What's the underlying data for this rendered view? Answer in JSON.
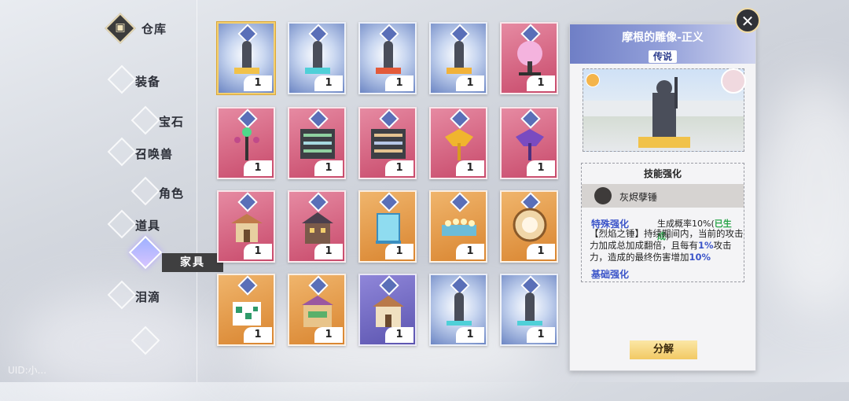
{
  "nav": {
    "storage_label": "仓库",
    "items": [
      "装备",
      "宝石",
      "召唤兽",
      "角色",
      "道具",
      "家具",
      "泪滴"
    ],
    "active_item": "家具",
    "uid_label": "UID:小..."
  },
  "inventory": {
    "counts": [
      "1",
      "1",
      "1",
      "1",
      "1",
      "1",
      "1",
      "1",
      "1",
      "1",
      "1",
      "1",
      "1",
      "1",
      "1",
      "1",
      "1",
      "1",
      "1",
      "1"
    ]
  },
  "detail": {
    "title": "摩根的雕像-正义",
    "rarity": "传说",
    "skill_section": "技能强化",
    "skill_name": "灰烬孽锤",
    "special_title": "特殊强化",
    "special_rate_prefix": "生成概率10%(",
    "special_rate_status": "已生成",
    "special_rate_suffix": ")",
    "desc_1": "【烈焰之锤】持续期间内，当前的攻击力加成总加成翻倍，且每有",
    "desc_1_pct": "1%",
    "desc_2": "攻击力，造成的最终伤害增加",
    "desc_2_pct": "10%",
    "base_title": "基础强化",
    "decompose_label": "分解"
  },
  "colors": {
    "accent_blue": "#3b54c9",
    "generated_green": "#2aa54a",
    "gold": "#f2c964"
  }
}
